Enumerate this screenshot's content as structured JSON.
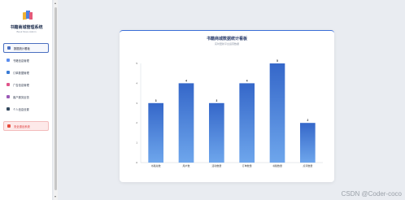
{
  "sidebar": {
    "title": "书籍商城管理系统",
    "subtitle": "Book Store Admin",
    "items": [
      {
        "label": "数据统计看板",
        "icon": "chart-icon",
        "color": "#4a6fc0",
        "active": true
      },
      {
        "label": "书籍信息管理",
        "icon": "book-icon",
        "color": "#5b8def",
        "active": false
      },
      {
        "label": "订单数据管理",
        "icon": "order-icon",
        "color": "#3a7bd5",
        "active": false
      },
      {
        "label": "广告信息管理",
        "icon": "ad-icon",
        "color": "#e0548a",
        "active": false
      },
      {
        "label": "客户服务反馈",
        "icon": "feedback-icon",
        "color": "#9b59b6",
        "active": false
      },
      {
        "label": "个人信息设置",
        "icon": "user-icon",
        "color": "#34495e",
        "active": false
      }
    ],
    "logout_label": "安全退出系统"
  },
  "card": {
    "title": "书籍商城数据统计看板",
    "subtitle": "实时更新平台运营数据"
  },
  "chart_data": {
    "type": "bar",
    "categories": [
      "书籍总数",
      "用户数",
      "活动数量",
      "订单数量",
      "书籍数量",
      "点评数量"
    ],
    "values": [
      3,
      4,
      3,
      4,
      5,
      2
    ],
    "ylim": [
      0,
      5
    ],
    "yticks": [
      0,
      1,
      2,
      3,
      4,
      5
    ],
    "bar_color_top": "#3567c9",
    "bar_color_bottom": "#6ea6ec",
    "grid": false
  },
  "watermark": "CSDN @Coder-coco"
}
